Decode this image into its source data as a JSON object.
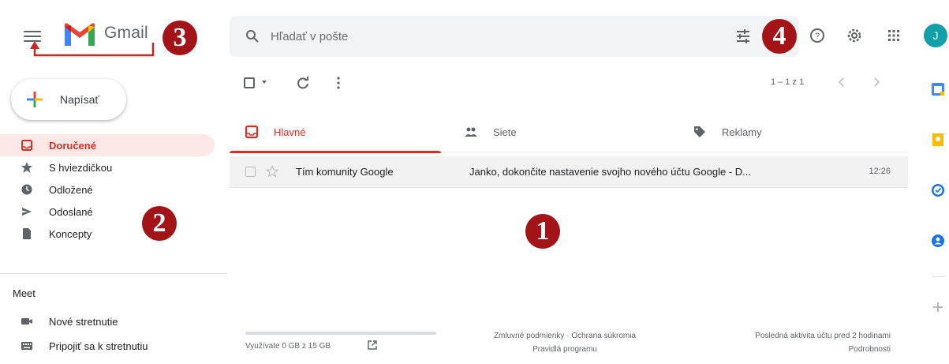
{
  "app": {
    "brand": "Gmail"
  },
  "search": {
    "placeholder": "Hľadať v pošte",
    "value": ""
  },
  "user": {
    "avatar_initial": "J",
    "avatar_color": "#12a0a8"
  },
  "compose": {
    "label": "Napísať"
  },
  "nav": {
    "items": [
      {
        "label": "Doručené",
        "icon": "inbox-icon",
        "active": true
      },
      {
        "label": "S hviezdičkou",
        "icon": "star-icon"
      },
      {
        "label": "Odložené",
        "icon": "clock-icon"
      },
      {
        "label": "Odoslané",
        "icon": "send-icon"
      },
      {
        "label": "Koncepty",
        "icon": "draft-icon"
      }
    ]
  },
  "meet": {
    "title": "Meet",
    "items": [
      {
        "label": "Nové stretnutie",
        "icon": "videocam-icon"
      },
      {
        "label": "Pripojiť sa k stretnutiu",
        "icon": "keyboard-icon"
      }
    ]
  },
  "toolbar": {
    "pagination": "1 – 1 z 1"
  },
  "tabs": [
    {
      "label": "Hlavné",
      "icon": "inbox-icon",
      "active": true
    },
    {
      "label": "Siete",
      "icon": "people-icon"
    },
    {
      "label": "Reklamy",
      "icon": "tag-icon"
    }
  ],
  "messages": [
    {
      "sender": "Tím komunity Google",
      "subject": "Janko, dokončite nastavenie svojho nového účtu Google - D...",
      "time": "12:26",
      "starred": false,
      "selected": false
    }
  ],
  "footer": {
    "storage": "Využívate 0 GB z 15 GB",
    "storage_used_fraction": 0,
    "terms": "Zmluvné podmienky",
    "separator": "·",
    "privacy": "Ochrana súkromia",
    "program_policies": "Pravidlá programu",
    "last_activity": "Posledná aktivita účtu pred 2 hodinami",
    "details": "Podrobnosti"
  },
  "markers": [
    "1",
    "2",
    "3",
    "4"
  ],
  "colors": {
    "accent_red": "#d93025",
    "active_bg": "#fce8e6",
    "marker": "#a31419",
    "search_bg": "#f1f3f4"
  }
}
